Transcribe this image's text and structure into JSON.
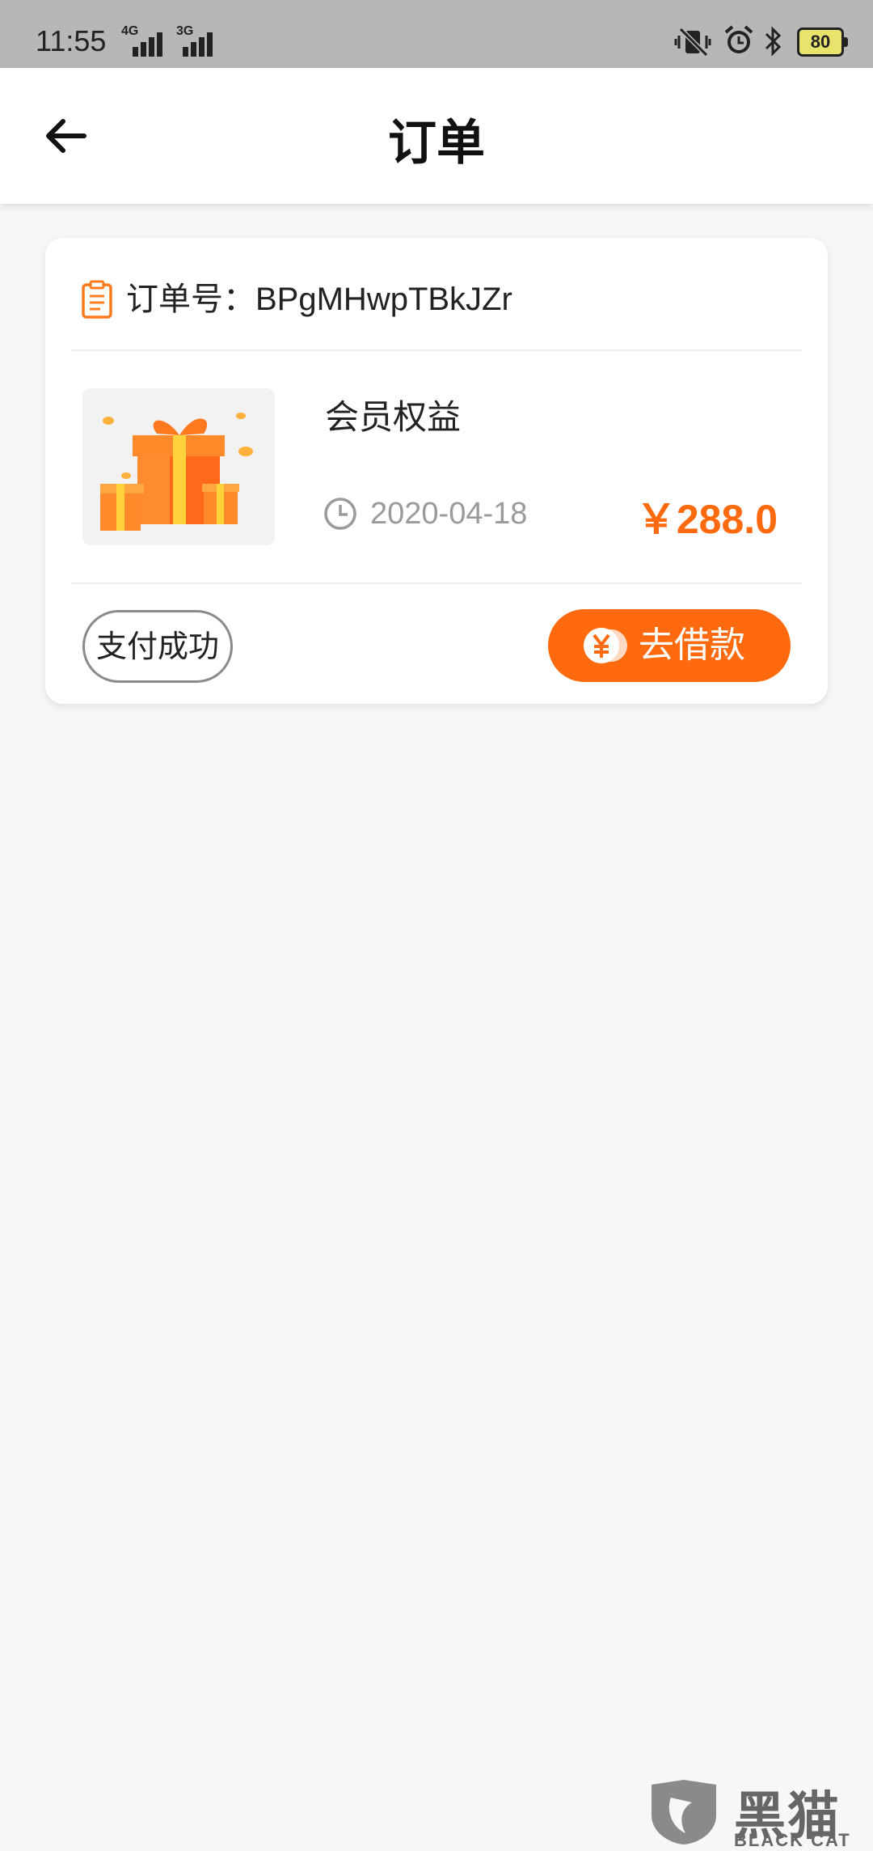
{
  "status_bar": {
    "time": "11:55",
    "network_1": "4G",
    "network_2": "3G",
    "battery": "80"
  },
  "header": {
    "title": "订单",
    "back_icon": "arrow-left-icon"
  },
  "order": {
    "order_label": "订单号：",
    "order_number": "BPgMHwpTBkJZr",
    "product_name": "会员权益",
    "date": "2020-04-18",
    "price": "￥288.0",
    "status": "支付成功",
    "action_label": "去借款"
  },
  "watermark": {
    "cn": "黑猫",
    "en": "BLACK CAT"
  },
  "colors": {
    "accent": "#ff6a0f",
    "background": "#f7f7f7",
    "statusbar": "#b7b7b7"
  }
}
